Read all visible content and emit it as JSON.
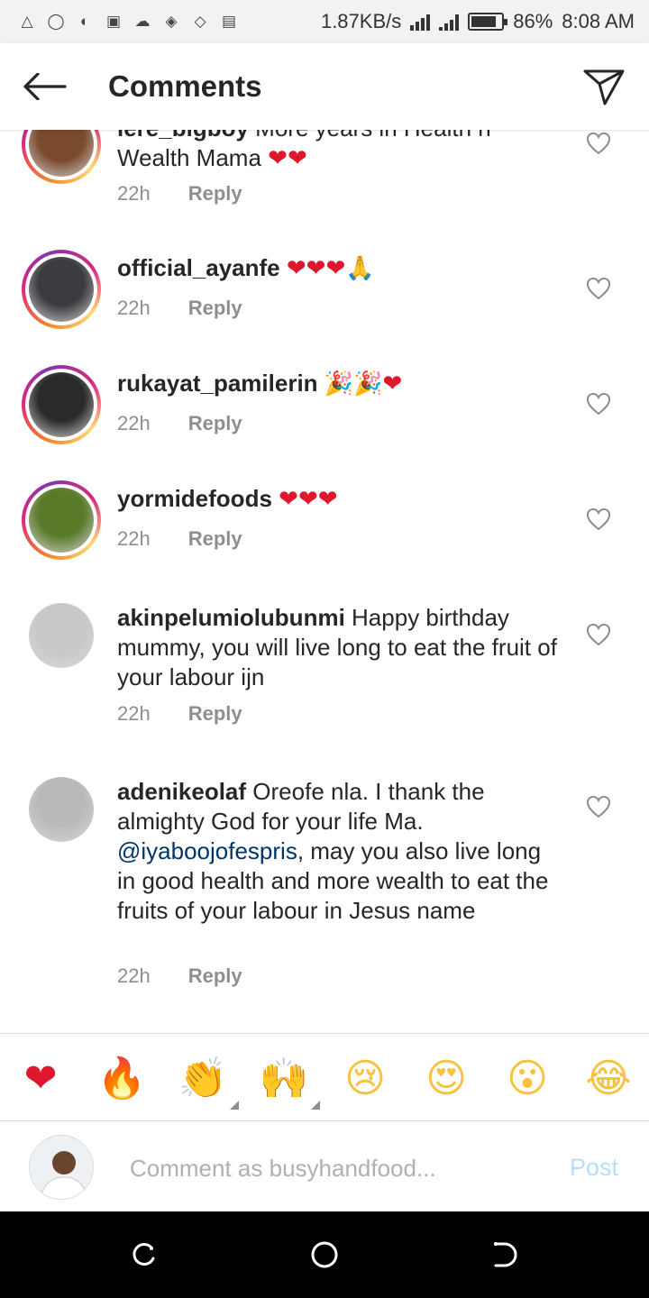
{
  "status_bar": {
    "speed": "1.87KB/s",
    "battery_percent": "86%",
    "battery_level": 0.86,
    "time": "8:08 AM"
  },
  "header": {
    "title": "Comments"
  },
  "comments": [
    {
      "user": "lere_bigboy",
      "text": "More years in Health n Wealth Mama",
      "emojis": "❤❤",
      "time": "22h",
      "reply": "Reply",
      "avatar_color": "#7a4a2c",
      "story_ring": true
    },
    {
      "user": "official_ayanfe",
      "text": "",
      "emojis": "❤❤❤🙏",
      "time": "22h",
      "reply": "Reply",
      "avatar_color": "#3b3b40",
      "story_ring": true
    },
    {
      "user": "rukayat_pamilerin",
      "text": "",
      "emojis": "🎉🎉❤",
      "time": "22h",
      "reply": "Reply",
      "avatar_color": "#2a2a2a",
      "story_ring": true
    },
    {
      "user": "yormidefoods",
      "text": "",
      "emojis": "❤❤❤",
      "time": "22h",
      "reply": "Reply",
      "avatar_color": "#5a7a2a",
      "story_ring": true
    },
    {
      "user": "akinpelumiolubunmi",
      "text": "Happy birthday mummy, you will live long to eat the fruit of your labour ijn",
      "time": "22h",
      "reply": "Reply",
      "avatar_color": "#c8c8c8",
      "story_ring": false
    },
    {
      "user": "adenikeolaf",
      "text_before": "Oreofe nla. I thank the almighty God for your life Ma.",
      "mention": "@iyaboojofespris",
      "text_after": ", may you also live long in good health and more wealth to eat the fruits of your labour in Jesus name",
      "time": "22h",
      "reply": "Reply",
      "avatar_color": "#b9b9b9",
      "story_ring": false
    }
  ],
  "emoji_bar": [
    {
      "name": "red-heart-emoji",
      "glyph": "❤",
      "color": "#e0172c"
    },
    {
      "name": "fire-emoji",
      "glyph": "🔥",
      "color": "#f58529"
    },
    {
      "name": "clapping-hands-emoji",
      "glyph": "👏",
      "color": "#f7c23e"
    },
    {
      "name": "raising-hands-emoji",
      "glyph": "🙌",
      "color": "#f7c23e"
    },
    {
      "name": "crying-face-emoji",
      "glyph": "😢",
      "color": "#f7c23e"
    },
    {
      "name": "heart-eyes-emoji",
      "glyph": "😍",
      "color": "#f7c23e"
    },
    {
      "name": "surprised-face-emoji",
      "glyph": "😮",
      "color": "#f7c23e"
    },
    {
      "name": "tears-of-joy-emoji",
      "glyph": "😂",
      "color": "#f7c23e"
    }
  ],
  "composer": {
    "placeholder": "Comment as busyhandfood...",
    "post_label": "Post"
  },
  "colors": {
    "username": "#262626",
    "meta": "#8e8e8e",
    "mention": "#003569",
    "post_disabled": "#b2dffc",
    "heart_emoji": "#e0172c"
  }
}
